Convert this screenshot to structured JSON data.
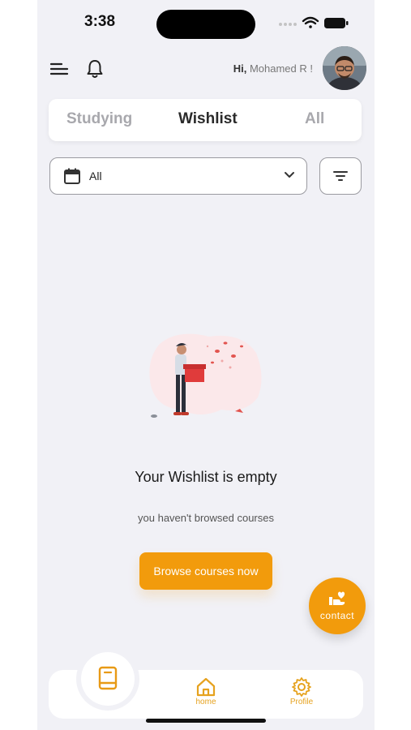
{
  "status_bar": {
    "time": "3:38"
  },
  "header": {
    "greeting_prefix": "Hi,",
    "greeting_name": "Mohamed R !"
  },
  "tabs": [
    {
      "label": "Studying",
      "active": false
    },
    {
      "label": "Wishlist",
      "active": true
    },
    {
      "label": "All",
      "active": false
    }
  ],
  "filter": {
    "date_value": "All"
  },
  "empty_state": {
    "title": "Your Wishlist is empty",
    "subtitle": "you haven't browsed courses",
    "button_label": "Browse courses now"
  },
  "fab": {
    "label": "contact"
  },
  "bottom_nav": {
    "items": [
      {
        "label": "home",
        "icon": "home-icon"
      },
      {
        "label": "Profile",
        "icon": "gear-icon"
      }
    ],
    "center_icon": "book-icon"
  },
  "colors": {
    "accent": "#f29b0c",
    "background": "#f1f1f6",
    "nav_label": "#e6a21e"
  }
}
